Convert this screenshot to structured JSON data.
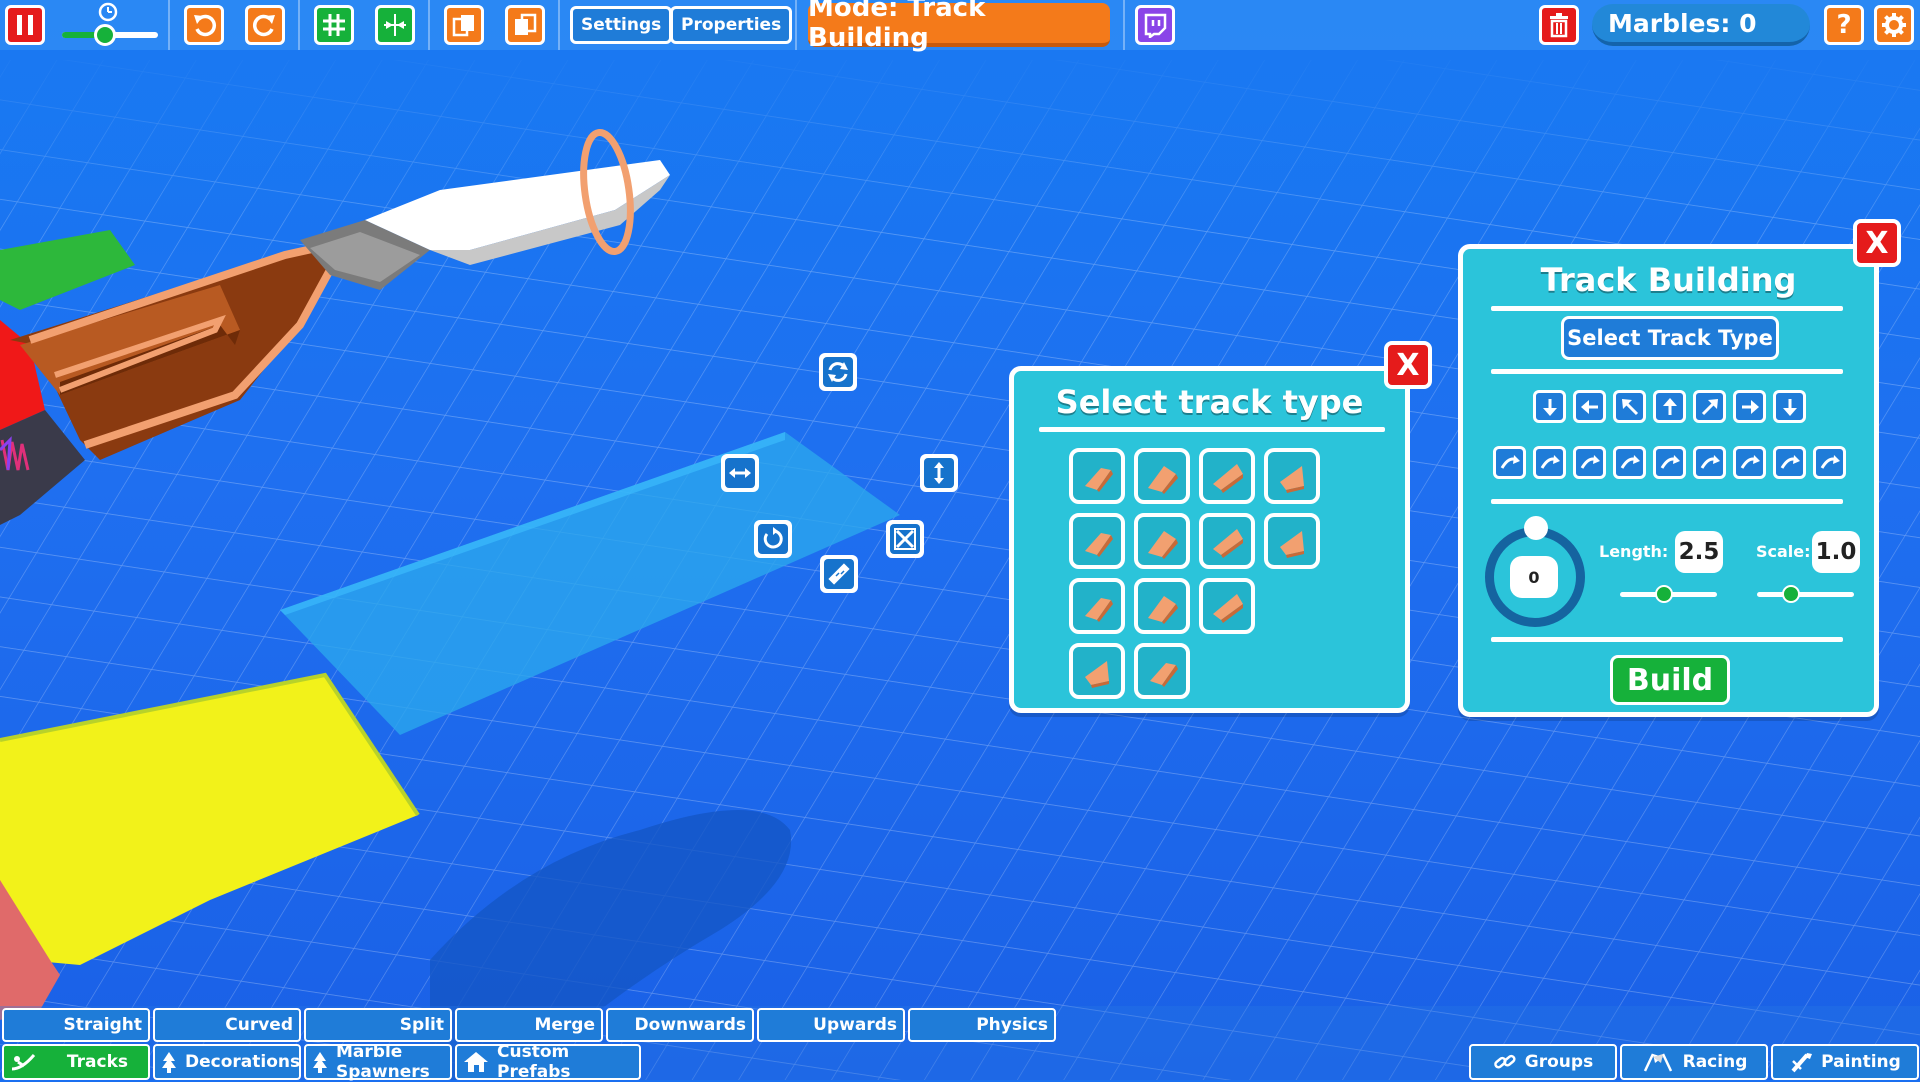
{
  "topbar": {
    "buttons": [
      {
        "name": "pause",
        "icon": "pause-icon"
      },
      {
        "name": "undo",
        "icon": "undo-icon"
      },
      {
        "name": "redo",
        "icon": "redo-icon"
      },
      {
        "name": "grid",
        "icon": "grid-icon"
      },
      {
        "name": "snap",
        "icon": "snap-icon"
      },
      {
        "name": "copy",
        "icon": "copy-icon"
      },
      {
        "name": "paste",
        "icon": "paste-icon"
      },
      {
        "name": "twitch",
        "icon": "twitch-icon"
      },
      {
        "name": "delete",
        "icon": "trash-icon"
      },
      {
        "name": "help",
        "icon": "help-icon"
      },
      {
        "name": "settings-gear",
        "icon": "gear-icon"
      }
    ],
    "settings_label": "Settings",
    "properties_label": "Properties",
    "mode_label": "Mode: Track Building",
    "marbles_label": "Marbles: 0",
    "help_glyph": "?",
    "speed_slider_level": 0.45
  },
  "select_track_panel": {
    "title": "Select track type",
    "close_label": "X",
    "tile_rows": [
      4,
      4,
      3,
      2
    ]
  },
  "track_building_panel": {
    "title": "Track Building",
    "close_label": "X",
    "select_button_label": "Select Track Type",
    "direction_row1": [
      "down-arrow-icon",
      "left-arrow-icon",
      "up-left-arrow-icon",
      "up-arrow-icon",
      "up-right-arrow-icon",
      "right-arrow-icon",
      "down-arrow-icon"
    ],
    "direction_row2_count": 9,
    "rotation_value": "0",
    "length_label": "Length:",
    "length_value": "2.5",
    "length_slider_level": 0.45,
    "scale_label": "Scale:",
    "scale_value": "1.0",
    "scale_slider_level": 0.35,
    "build_label": "Build"
  },
  "category_buttons": [
    "Straight",
    "Curved",
    "Split",
    "Merge",
    "Downwards",
    "Upwards",
    "Physics"
  ],
  "bottom_tabs_left": [
    {
      "label": "Tracks",
      "icon": "slide-icon",
      "active": true
    },
    {
      "label": "Decorations",
      "icon": "tree-icon",
      "active": false
    },
    {
      "label": "Marble Spawners",
      "icon": "tree-icon",
      "active": false
    },
    {
      "label": "Custom Prefabs",
      "icon": "house-icon",
      "active": false
    }
  ],
  "bottom_tabs_right": [
    {
      "label": "Groups",
      "icon": "link-icon"
    },
    {
      "label": "Racing",
      "icon": "flags-icon"
    },
    {
      "label": "Painting",
      "icon": "brush-icon"
    }
  ],
  "colors": {
    "accent_orange": "#f47a1a",
    "panel_cyan": "#2bc4da",
    "close_red": "#e51b1b",
    "button_blue": "#1f7cd8",
    "build_green": "#16b13a"
  }
}
